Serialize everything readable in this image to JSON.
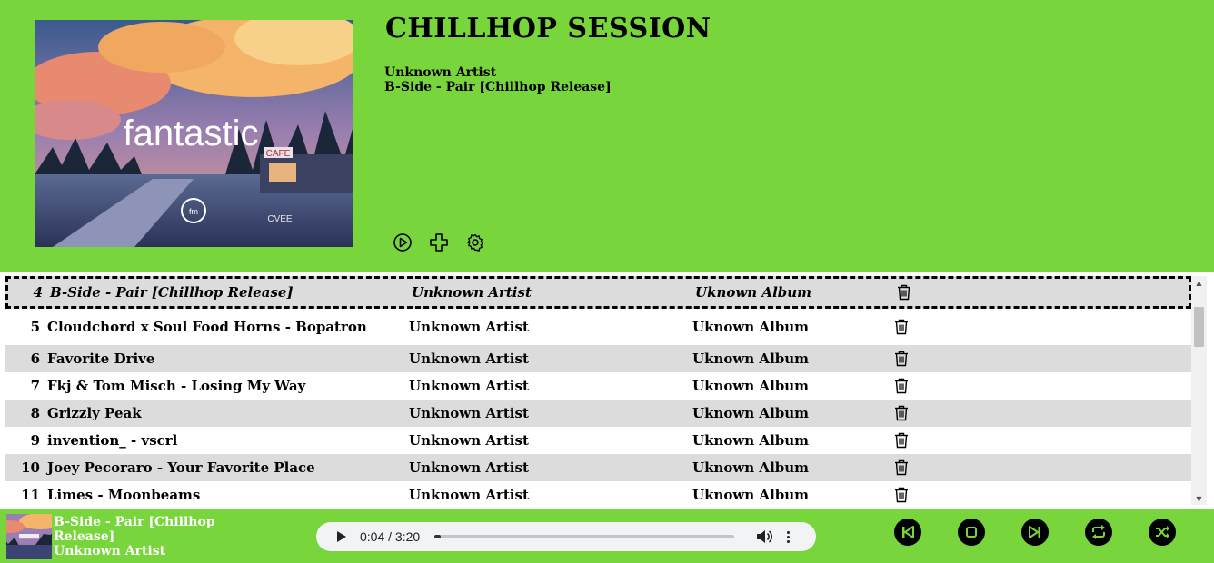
{
  "header": {
    "title": "CHILLHOP SESSION",
    "artist": "Unknown Artist",
    "track": "B-Side - Pair [Chillhop Release]",
    "cover_text": "fantastic",
    "cover_sign": "CAFE",
    "cover_sign2": "CVEE",
    "cover_badge": "fm"
  },
  "playlist": {
    "rows": [
      {
        "num": "4",
        "title": "B-Side - Pair [Chillhop Release]",
        "artist": "Unknown Artist",
        "album": "Uknown Album",
        "active": true
      },
      {
        "num": "5",
        "title": "Cloudchord x Soul Food Horns - Bopatron",
        "artist": "Unknown Artist",
        "album": "Uknown Album"
      },
      {
        "num": "6",
        "title": "Favorite Drive",
        "artist": "Unknown Artist",
        "album": "Uknown Album"
      },
      {
        "num": "7",
        "title": "Fkj & Tom Misch - Losing My Way",
        "artist": "Unknown Artist",
        "album": "Uknown Album"
      },
      {
        "num": "8",
        "title": "Grizzly Peak",
        "artist": "Unknown Artist",
        "album": "Uknown Album"
      },
      {
        "num": "9",
        "title": "invention_ - vscrl",
        "artist": "Unknown Artist",
        "album": "Uknown Album"
      },
      {
        "num": "10",
        "title": "Joey Pecoraro - Your Favorite Place",
        "artist": "Unknown Artist",
        "album": "Uknown Album"
      },
      {
        "num": "11",
        "title": "Limes - Moonbeams",
        "artist": "Unknown Artist",
        "album": "Uknown Album"
      }
    ]
  },
  "footer": {
    "now_playing_title": "B-Side - Pair [Chillhop Release]",
    "now_playing_artist": "Unknown Artist",
    "audio_time": "0:04 / 3:20",
    "audio_progress": 0.02
  },
  "colors": {
    "accent": "#78d63c",
    "row_alt": "#dcdcdc",
    "control_bg": "#000000"
  },
  "icons": {
    "header_actions": [
      "play-circle-icon",
      "plus-icon",
      "gear-icon"
    ],
    "row_action": "trash-icon",
    "controls": [
      "skip-previous-icon",
      "stop-icon",
      "skip-next-icon",
      "repeat-icon",
      "shuffle-icon"
    ]
  }
}
